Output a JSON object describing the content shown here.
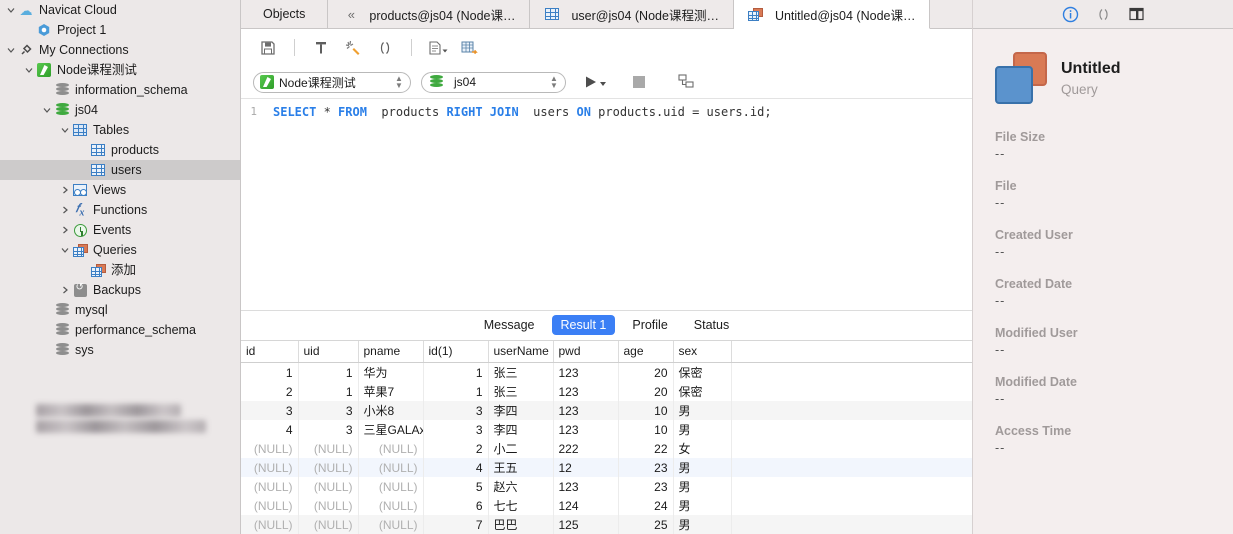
{
  "sidebar": {
    "items": [
      {
        "label": "Navicat Cloud",
        "icon": "cloud-icon",
        "indent": 0,
        "twisty": "down",
        "selected": false
      },
      {
        "label": "Project 1",
        "icon": "project-icon",
        "indent": 1,
        "twisty": "",
        "selected": false
      },
      {
        "label": "My Connections",
        "icon": "plug-icon",
        "indent": 0,
        "twisty": "down",
        "selected": false
      },
      {
        "label": "Node课程测试",
        "icon": "navicat-connection-icon",
        "indent": 1,
        "twisty": "down",
        "selected": false
      },
      {
        "label": "information_schema",
        "icon": "database-icon",
        "indent": 2,
        "twisty": "",
        "selected": false
      },
      {
        "label": "js04",
        "icon": "database-green-icon",
        "indent": 2,
        "twisty": "down",
        "selected": false
      },
      {
        "label": "Tables",
        "icon": "tables-folder-icon",
        "indent": 3,
        "twisty": "down",
        "selected": false
      },
      {
        "label": "products",
        "icon": "table-icon",
        "indent": 4,
        "twisty": "",
        "selected": false
      },
      {
        "label": "users",
        "icon": "table-icon",
        "indent": 4,
        "twisty": "",
        "selected": true
      },
      {
        "label": "Views",
        "icon": "views-icon",
        "indent": 3,
        "twisty": "right",
        "selected": false
      },
      {
        "label": "Functions",
        "icon": "functions-icon",
        "indent": 3,
        "twisty": "right",
        "selected": false
      },
      {
        "label": "Events",
        "icon": "events-icon",
        "indent": 3,
        "twisty": "right",
        "selected": false
      },
      {
        "label": "Queries",
        "icon": "queries-icon",
        "indent": 3,
        "twisty": "down",
        "selected": false
      },
      {
        "label": "添加",
        "icon": "query-icon",
        "indent": 4,
        "twisty": "",
        "selected": false
      },
      {
        "label": "Backups",
        "icon": "backups-icon",
        "indent": 3,
        "twisty": "right",
        "selected": false
      },
      {
        "label": "mysql",
        "icon": "database-icon",
        "indent": 2,
        "twisty": "",
        "selected": false
      },
      {
        "label": "performance_schema",
        "icon": "database-icon",
        "indent": 2,
        "twisty": "",
        "selected": false
      },
      {
        "label": "sys",
        "icon": "database-icon",
        "indent": 2,
        "twisty": "",
        "selected": false
      }
    ]
  },
  "tabs": [
    {
      "label": "Objects",
      "icon": "none",
      "active": false
    },
    {
      "label": "products@js04 (Node课…",
      "icon": "collapse-icon",
      "active": false
    },
    {
      "label": "user@js04 (Node课程测…",
      "icon": "table-icon",
      "active": false
    },
    {
      "label": "Untitled@js04 (Node课…",
      "icon": "query-icon",
      "active": true
    }
  ],
  "right_header_icons": [
    "info-icon",
    "parentheses-icon",
    "table-panel-icon"
  ],
  "editor_toolbar": {
    "buttons": [
      {
        "name": "save-button",
        "icon": "save-icon"
      },
      {
        "name": "beautify-button",
        "icon": "beautify-icon"
      },
      {
        "name": "format-button",
        "icon": "magic-wand-icon"
      },
      {
        "name": "parentheses-button",
        "icon": "parentheses-icon"
      },
      {
        "name": "export-result-button",
        "icon": "document-dropdown-icon"
      },
      {
        "name": "query-builder-button",
        "icon": "query-builder-icon"
      }
    ]
  },
  "connection_bar": {
    "connection": "Node课程测试",
    "database": "js04",
    "run_label": "",
    "stop_label": "",
    "explain_label": ""
  },
  "sql": {
    "line_number": "1",
    "tokens": [
      {
        "t": "SELECT",
        "k": true
      },
      {
        "t": " * ",
        "k": false
      },
      {
        "t": "FROM",
        "k": true
      },
      {
        "t": "  products ",
        "k": false
      },
      {
        "t": "RIGHT JOIN",
        "k": true
      },
      {
        "t": "  users ",
        "k": false
      },
      {
        "t": "ON",
        "k": true
      },
      {
        "t": " products.uid = users.id;",
        "k": false
      }
    ]
  },
  "result_tabs": [
    {
      "label": "Message",
      "active": false
    },
    {
      "label": "Result 1",
      "active": true
    },
    {
      "label": "Profile",
      "active": false
    },
    {
      "label": "Status",
      "active": false
    }
  ],
  "grid": {
    "columns": [
      "id",
      "uid",
      "pname",
      "id(1)",
      "userName",
      "pwd",
      "age",
      "sex",
      ""
    ],
    "rows": [
      {
        "cells": [
          "1",
          "1",
          "华为",
          "1",
          "张三",
          "123",
          "20",
          "保密",
          ""
        ],
        "style": "plain"
      },
      {
        "cells": [
          "2",
          "1",
          "苹果7",
          "1",
          "张三",
          "123",
          "20",
          "保密",
          ""
        ],
        "style": "plain"
      },
      {
        "cells": [
          "3",
          "3",
          "小米8",
          "3",
          "李四",
          "123",
          "10",
          "男",
          ""
        ],
        "style": "alt"
      },
      {
        "cells": [
          "4",
          "3",
          "三星GALAx",
          "3",
          "李四",
          "123",
          "10",
          "男",
          ""
        ],
        "style": "plain"
      },
      {
        "cells": [
          "(NULL)",
          "(NULL)",
          "(NULL)",
          "2",
          "小二",
          "222",
          "22",
          "女",
          ""
        ],
        "style": "plain"
      },
      {
        "cells": [
          "(NULL)",
          "(NULL)",
          "(NULL)",
          "4",
          "王五",
          "12",
          "23",
          "男",
          ""
        ],
        "style": "sel"
      },
      {
        "cells": [
          "(NULL)",
          "(NULL)",
          "(NULL)",
          "5",
          "赵六",
          "123",
          "23",
          "男",
          ""
        ],
        "style": "plain"
      },
      {
        "cells": [
          "(NULL)",
          "(NULL)",
          "(NULL)",
          "6",
          "七七",
          "124",
          "24",
          "男",
          ""
        ],
        "style": "plain"
      },
      {
        "cells": [
          "(NULL)",
          "(NULL)",
          "(NULL)",
          "7",
          "巴巴",
          "125",
          "25",
          "男",
          ""
        ],
        "style": "alt"
      }
    ]
  },
  "info_panel": {
    "title": "Untitled",
    "subtitle": "Query",
    "fields": [
      {
        "label": "File Size",
        "value": "--"
      },
      {
        "label": "File",
        "value": "--"
      },
      {
        "label": "Created User",
        "value": "--"
      },
      {
        "label": "Created Date",
        "value": "--"
      },
      {
        "label": "Modified User",
        "value": "--"
      },
      {
        "label": "Modified Date",
        "value": "--"
      },
      {
        "label": "Access Time",
        "value": "--"
      }
    ]
  },
  "colors": {
    "accent": "#3b7ff5",
    "sidebar_bg": "#ece8e8",
    "panel_bg": "#f4eeee",
    "keyword": "#2a7fe8"
  }
}
